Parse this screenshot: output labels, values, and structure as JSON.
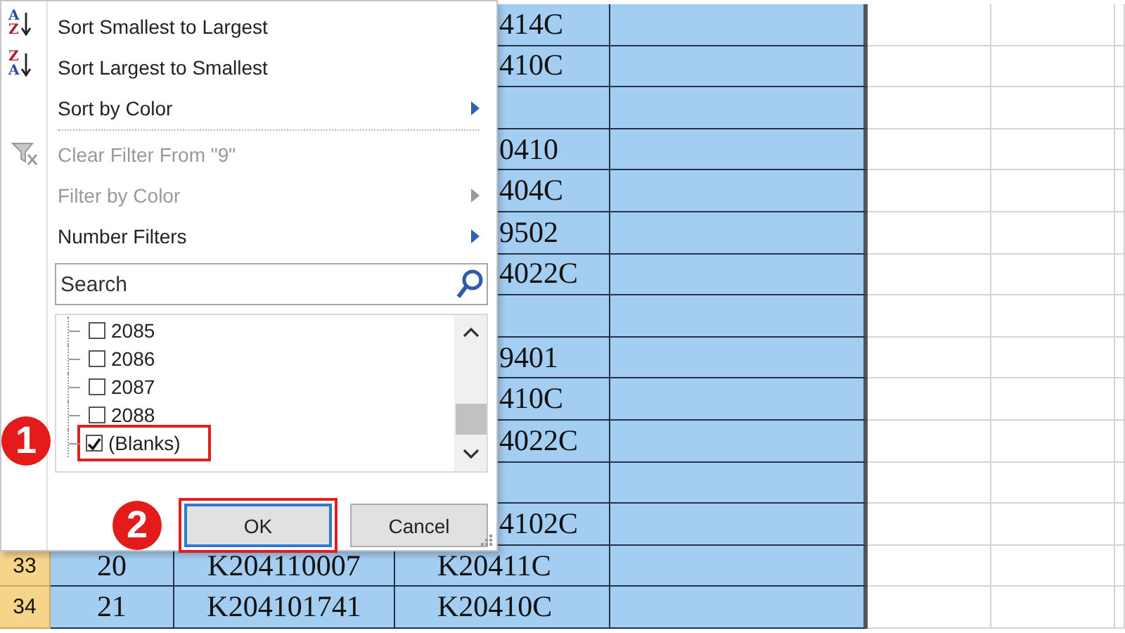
{
  "sheet": {
    "rows": [
      {
        "kind": "covered",
        "c": "414C"
      },
      {
        "kind": "covered",
        "c": "410C"
      },
      {
        "kind": "covered",
        "c": ""
      },
      {
        "kind": "covered",
        "c": "0410"
      },
      {
        "kind": "covered",
        "c": "404C"
      },
      {
        "kind": "covered",
        "c": "9502"
      },
      {
        "kind": "covered",
        "c": "4022C"
      },
      {
        "kind": "covered",
        "c": ""
      },
      {
        "kind": "covered",
        "c": "9401"
      },
      {
        "kind": "covered",
        "c": "410C"
      },
      {
        "kind": "covered",
        "c": "4022C"
      },
      {
        "kind": "covered",
        "c": ""
      },
      {
        "kind": "covered",
        "c": "4102C"
      },
      {
        "kind": "open",
        "header": "33",
        "a": "20",
        "b": "K204110007",
        "c": "K20411C"
      },
      {
        "kind": "open",
        "header": "34",
        "a": "21",
        "b": "K204101741",
        "c": "K20410C"
      }
    ]
  },
  "filter_menu": {
    "items": [
      {
        "kind": "sort",
        "icon_top": "A",
        "icon_bottom": "Z",
        "label": "Sort Smallest to Largest",
        "disabled": false,
        "submenu": false
      },
      {
        "kind": "sort",
        "icon_top": "Z",
        "icon_bottom": "A",
        "label": "Sort Largest to Smallest",
        "disabled": false,
        "submenu": false
      },
      {
        "kind": "plain",
        "label": "Sort by Color",
        "disabled": false,
        "submenu": true
      },
      {
        "kind": "separator"
      },
      {
        "kind": "clear",
        "label": "Clear Filter From \"9\"",
        "disabled": true,
        "submenu": false
      },
      {
        "kind": "plain",
        "label": "Filter by Color",
        "disabled": true,
        "submenu": true
      },
      {
        "kind": "plain",
        "label": "Number Filters",
        "disabled": false,
        "submenu": true
      }
    ],
    "search": {
      "placeholder": "Search"
    },
    "values": [
      {
        "label": "2085",
        "checked": false,
        "highlighted": false
      },
      {
        "label": "2086",
        "checked": false,
        "highlighted": false
      },
      {
        "label": "2087",
        "checked": false,
        "highlighted": false
      },
      {
        "label": "2088",
        "checked": false,
        "highlighted": false
      },
      {
        "label": "(Blanks)",
        "checked": true,
        "highlighted": true
      }
    ],
    "buttons": [
      {
        "label": "OK",
        "focused": true,
        "highlighted": true
      },
      {
        "label": "Cancel",
        "focused": false,
        "highlighted": false
      }
    ]
  },
  "callouts": [
    {
      "number": "1"
    },
    {
      "number": "2"
    }
  ]
}
